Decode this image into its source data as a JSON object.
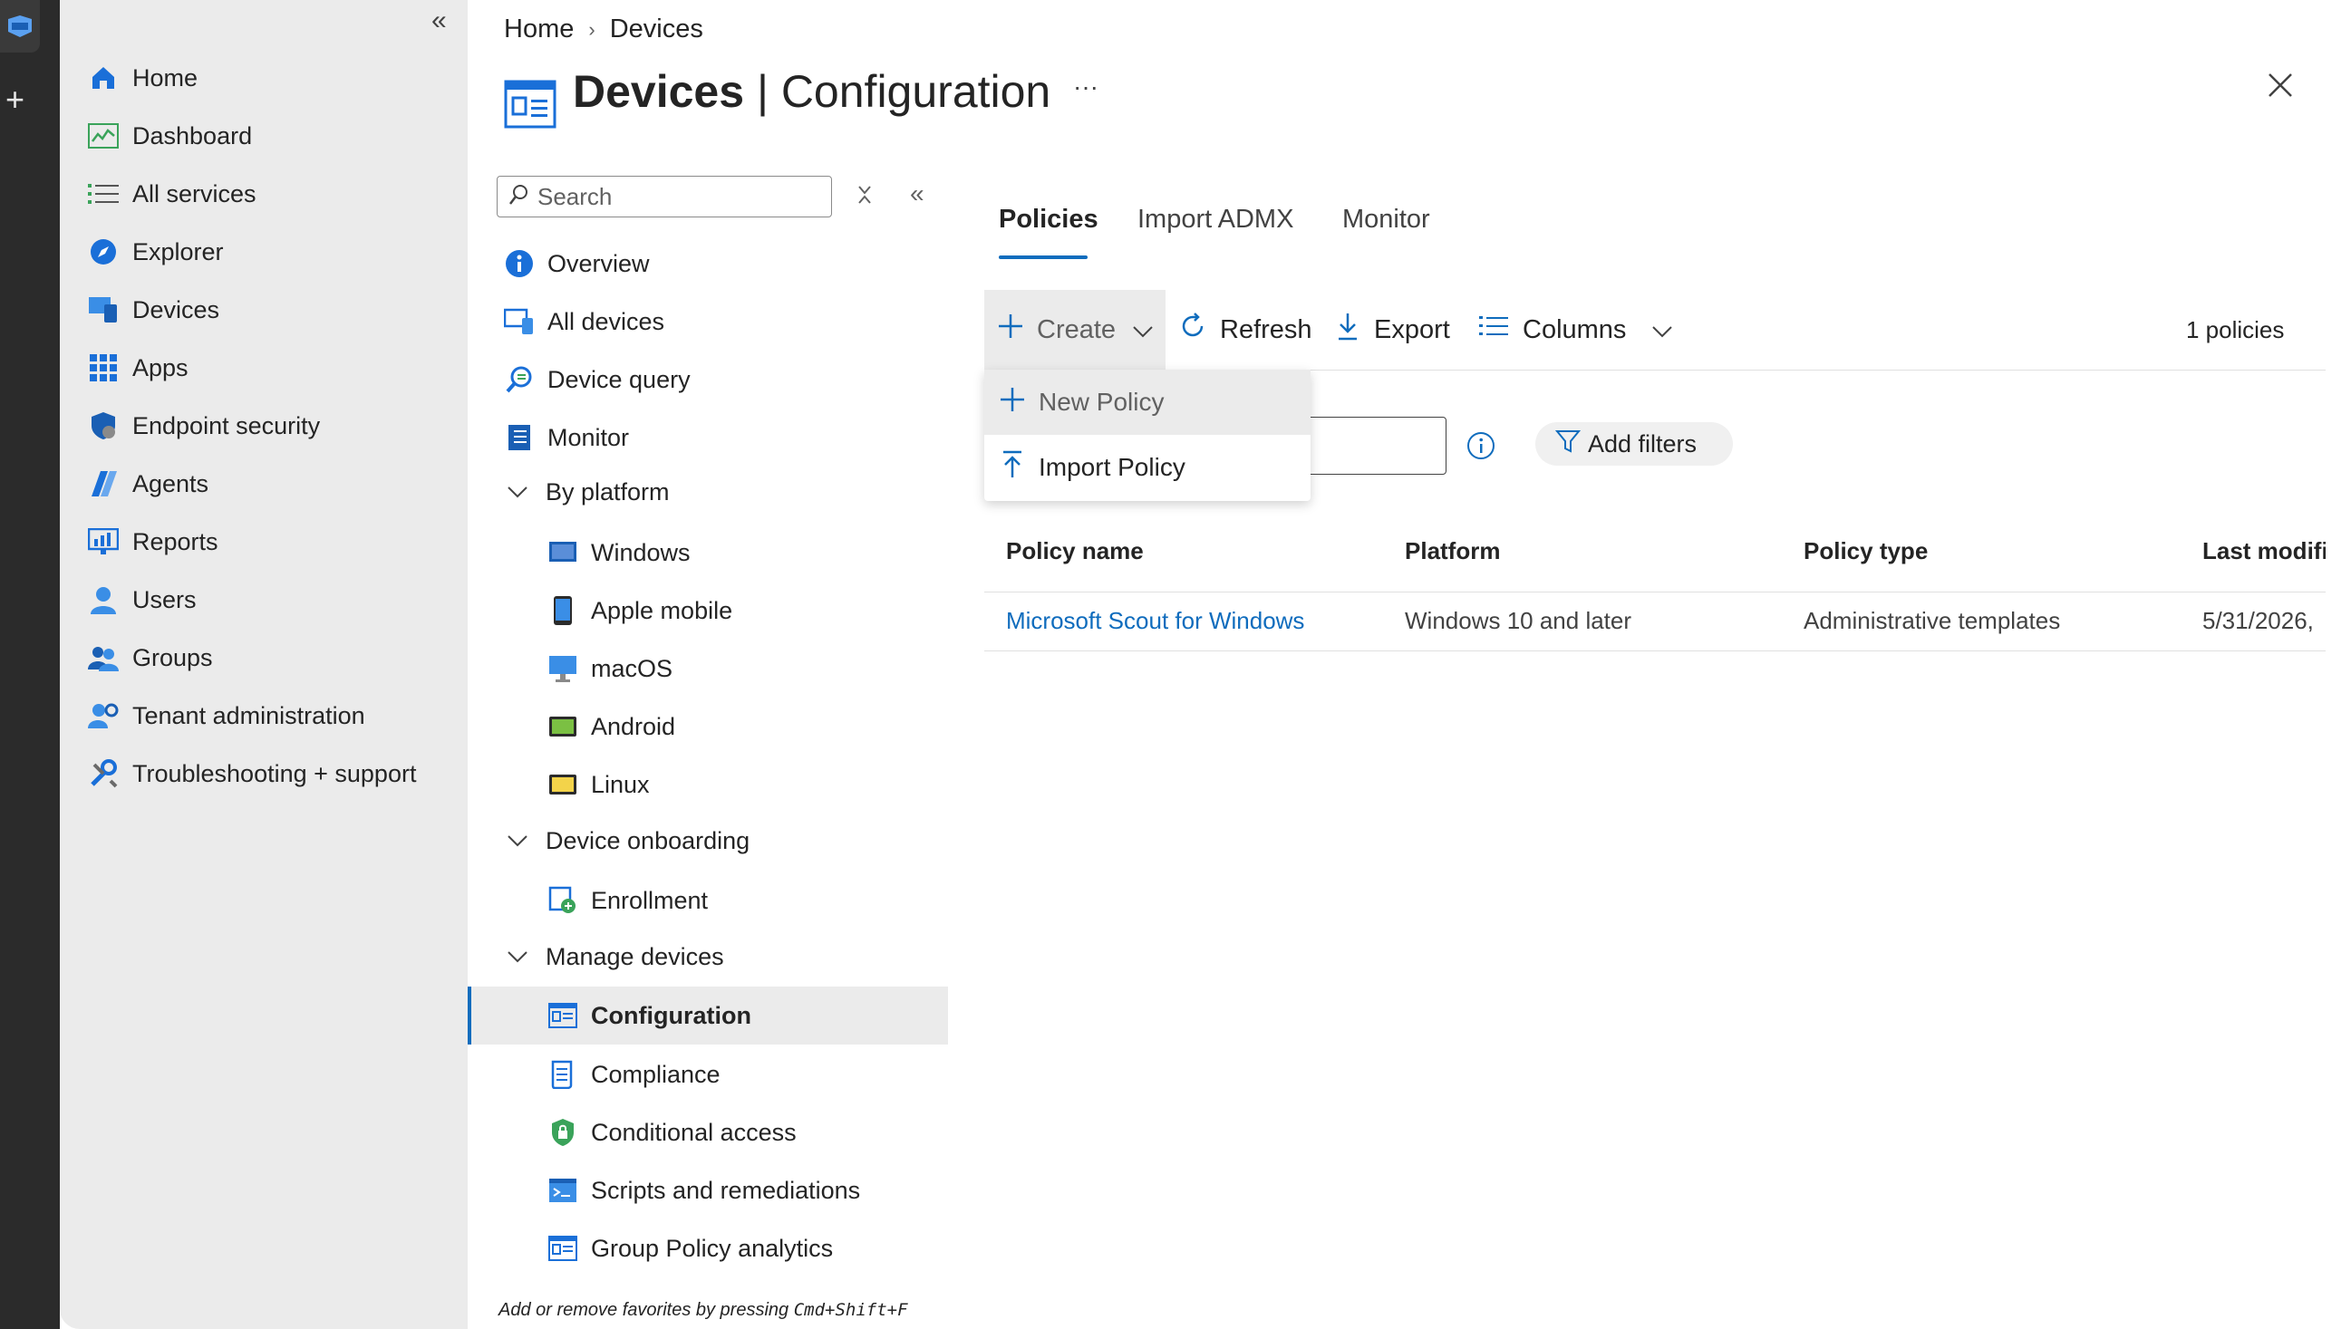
{
  "portal_nav": {
    "items": [
      {
        "label": "Home",
        "icon": "home-icon"
      },
      {
        "label": "Dashboard",
        "icon": "dashboard-icon"
      },
      {
        "label": "All services",
        "icon": "list-icon"
      },
      {
        "label": "Explorer",
        "icon": "explorer-icon"
      },
      {
        "label": "Devices",
        "icon": "devices-icon"
      },
      {
        "label": "Apps",
        "icon": "apps-icon"
      },
      {
        "label": "Endpoint security",
        "icon": "shield-icon"
      },
      {
        "label": "Agents",
        "icon": "agents-icon"
      },
      {
        "label": "Reports",
        "icon": "reports-icon"
      },
      {
        "label": "Users",
        "icon": "user-icon"
      },
      {
        "label": "Groups",
        "icon": "groups-icon"
      },
      {
        "label": "Tenant administration",
        "icon": "gear-person-icon"
      },
      {
        "label": "Troubleshooting + support",
        "icon": "wrench-icon"
      }
    ]
  },
  "breadcrumb": {
    "home": "Home",
    "sep": "›",
    "devices": "Devices"
  },
  "header": {
    "title_bold": "Devices",
    "title_sep": " | ",
    "title_light": "Configuration",
    "more": "···"
  },
  "subnav": {
    "search_placeholder": "Search",
    "items": {
      "overview": "Overview",
      "all_devices": "All devices",
      "device_query": "Device query",
      "monitor": "Monitor",
      "by_platform": "By platform",
      "windows": "Windows",
      "apple_mobile": "Apple mobile",
      "macos": "macOS",
      "android": "Android",
      "linux": "Linux",
      "device_onboarding": "Device onboarding",
      "enrollment": "Enrollment",
      "manage_devices": "Manage devices",
      "configuration": "Configuration",
      "compliance": "Compliance",
      "conditional_access": "Conditional access",
      "scripts": "Scripts and remediations",
      "gp_analytics": "Group Policy analytics"
    },
    "favorites_hint_pre": "Add or remove favorites by pressing ",
    "favorites_hint_keys": "Cmd+Shift+F"
  },
  "tabs": {
    "policies": "Policies",
    "import_admx": "Import ADMX",
    "monitor": "Monitor"
  },
  "toolbar": {
    "create": "Create",
    "refresh": "Refresh",
    "export": "Export",
    "columns": "Columns",
    "count": "1 policies"
  },
  "dropdown": {
    "new_policy": "New Policy",
    "import_policy": "Import Policy"
  },
  "filters": {
    "add_filters": "Add filters"
  },
  "table": {
    "headers": {
      "name": "Policy name",
      "platform": "Platform",
      "type": "Policy type",
      "modified": "Last modifi"
    },
    "rows": [
      {
        "name": "Microsoft Scout for Windows",
        "platform": "Windows 10 and later",
        "type": "Administrative templates",
        "modified": "5/31/2026,"
      }
    ]
  },
  "colors": {
    "accent": "#0f6cbd",
    "selected_bg": "#ebebeb",
    "nav_bg": "#ebebeb",
    "rail": "#2b2b2b"
  }
}
